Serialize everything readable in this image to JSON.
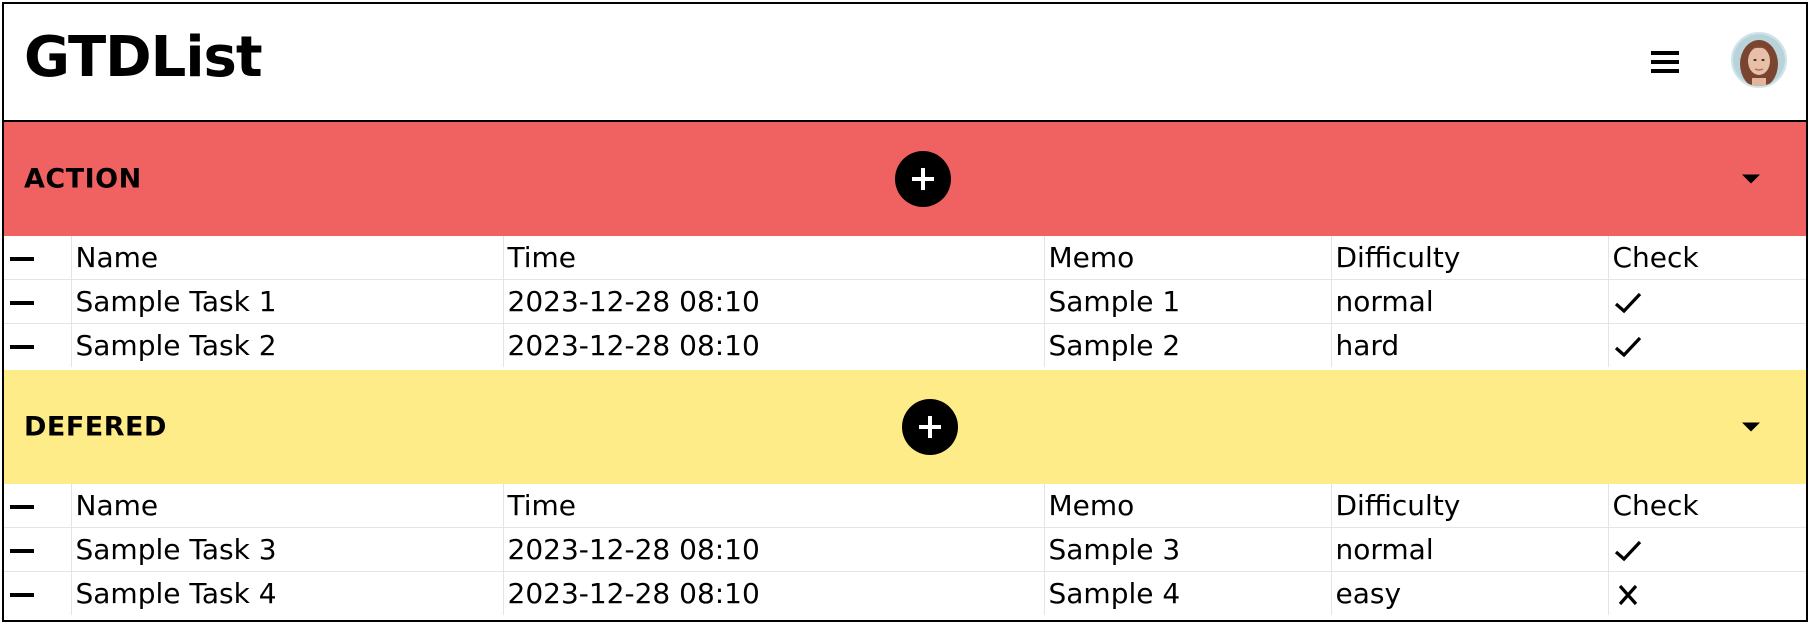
{
  "app": {
    "title": "GTDList"
  },
  "header": {
    "menu_icon": "hamburger-icon",
    "avatar": "user-avatar"
  },
  "sections": [
    {
      "title": "ACTION",
      "color": "#f06262",
      "columns": [
        "Name",
        "Time",
        "Memo",
        "Difficulty",
        "Check"
      ],
      "rows": [
        {
          "name": "Sample Task 1",
          "time": "2023-12-28 08:10",
          "memo": "Sample 1",
          "difficulty": "normal",
          "check": "check-icon"
        },
        {
          "name": "Sample Task 2",
          "time": "2023-12-28 08:10",
          "memo": "Sample 2",
          "difficulty": "hard",
          "check": "check-icon"
        }
      ]
    },
    {
      "title": "DEFERED",
      "color": "#fdec87",
      "columns": [
        "Name",
        "Time",
        "Memo",
        "Difficulty",
        "Check"
      ],
      "rows": [
        {
          "name": "Sample Task 3",
          "time": "2023-12-28 08:10",
          "memo": "Sample 3",
          "difficulty": "normal",
          "check": "check-icon"
        },
        {
          "name": "Sample Task 4",
          "time": "2023-12-28 08:10",
          "memo": "Sample 4",
          "difficulty": "easy",
          "check": "cross-icon"
        }
      ]
    }
  ]
}
